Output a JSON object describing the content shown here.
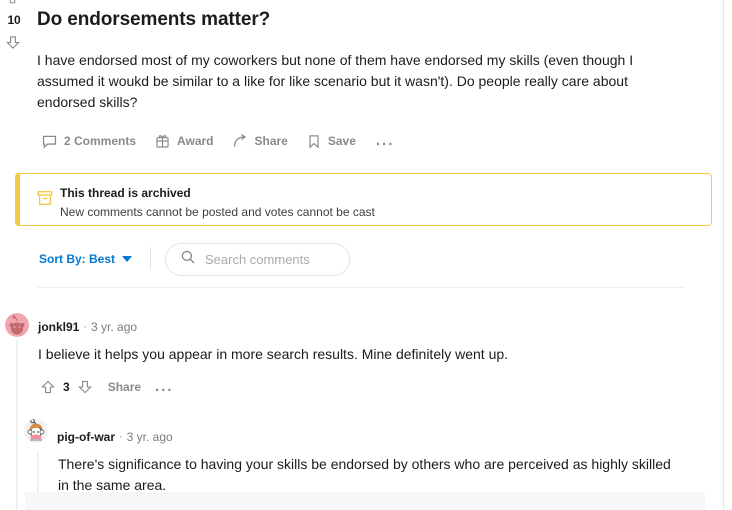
{
  "post": {
    "score": "10",
    "title": "Do endorsements matter?",
    "body": "I have endorsed most of my coworkers but none of them have endorsed my skills (even though I assumed it woukd be similar to a like for like scenario but it wasn't). Do people really care about endorsed skills?",
    "actions": {
      "comments_label": "2 Comments",
      "award_label": "Award",
      "share_label": "Share",
      "save_label": "Save",
      "more_label": "..."
    }
  },
  "archived_banner": {
    "title": "This thread is archived",
    "subtitle": "New comments cannot be posted and votes cannot be cast",
    "accent_color": "#f2cb45"
  },
  "comment_controls": {
    "sort_label": "Sort By: Best",
    "search_placeholder": "Search comments",
    "search_value": "",
    "link_color": "#0079d3"
  },
  "comments": [
    {
      "author": "jonkl91",
      "separator": "·",
      "timestamp": "3 yr. ago",
      "body": "I believe it helps you appear in more search results. Mine definitely went up.",
      "score": "3",
      "share_label": "Share",
      "more_label": "..."
    },
    {
      "author": "pig-of-war",
      "separator": "·",
      "timestamp": "3 yr. ago",
      "body": "There's significance to having your skills be endorsed by others who are perceived as highly skilled in the same area.",
      "score": "",
      "share_label": "",
      "more_label": ""
    }
  ]
}
